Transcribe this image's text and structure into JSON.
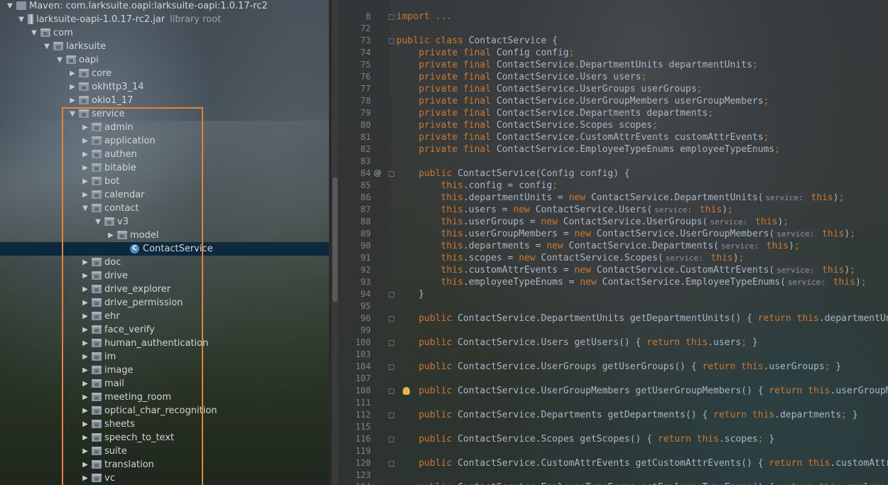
{
  "project_tree": {
    "nodes": [
      {
        "label": "Maven: com.larksuite.oapi:larksuite-oapi:1.0.17-rc2",
        "sublabel": "",
        "arrow": "▼",
        "icon": "maven"
      },
      {
        "label": "larksuite-oapi-1.0.17-rc2.jar",
        "sublabel": "library root",
        "arrow": "▼",
        "icon": "jar"
      },
      {
        "label": "com",
        "sublabel": "",
        "arrow": "▼",
        "icon": "package"
      },
      {
        "label": "larksuite",
        "sublabel": "",
        "arrow": "▼",
        "icon": "package"
      },
      {
        "label": "oapi",
        "sublabel": "",
        "arrow": "▼",
        "icon": "package"
      },
      {
        "label": "core",
        "sublabel": "",
        "arrow": "▶",
        "icon": "package"
      },
      {
        "label": "okhttp3_14",
        "sublabel": "",
        "arrow": "▶",
        "icon": "package"
      },
      {
        "label": "okio1_17",
        "sublabel": "",
        "arrow": "▶",
        "icon": "package"
      },
      {
        "label": "service",
        "sublabel": "",
        "arrow": "▼",
        "icon": "package"
      },
      {
        "label": "admin",
        "sublabel": "",
        "arrow": "▶",
        "icon": "package"
      },
      {
        "label": "application",
        "sublabel": "",
        "arrow": "▶",
        "icon": "package"
      },
      {
        "label": "authen",
        "sublabel": "",
        "arrow": "▶",
        "icon": "package"
      },
      {
        "label": "bitable",
        "sublabel": "",
        "arrow": "▶",
        "icon": "package"
      },
      {
        "label": "bot",
        "sublabel": "",
        "arrow": "▶",
        "icon": "package"
      },
      {
        "label": "calendar",
        "sublabel": "",
        "arrow": "▶",
        "icon": "package"
      },
      {
        "label": "contact",
        "sublabel": "",
        "arrow": "▼",
        "icon": "package"
      },
      {
        "label": "v3",
        "sublabel": "",
        "arrow": "▼",
        "icon": "package"
      },
      {
        "label": "model",
        "sublabel": "",
        "arrow": "▶",
        "icon": "package"
      },
      {
        "label": "ContactService",
        "sublabel": "",
        "arrow": "",
        "icon": "class"
      },
      {
        "label": "doc",
        "sublabel": "",
        "arrow": "▶",
        "icon": "package"
      },
      {
        "label": "drive",
        "sublabel": "",
        "arrow": "▶",
        "icon": "package"
      },
      {
        "label": "drive_explorer",
        "sublabel": "",
        "arrow": "▶",
        "icon": "package"
      },
      {
        "label": "drive_permission",
        "sublabel": "",
        "arrow": "▶",
        "icon": "package"
      },
      {
        "label": "ehr",
        "sublabel": "",
        "arrow": "▶",
        "icon": "package"
      },
      {
        "label": "face_verify",
        "sublabel": "",
        "arrow": "▶",
        "icon": "package"
      },
      {
        "label": "human_authentication",
        "sublabel": "",
        "arrow": "▶",
        "icon": "package"
      },
      {
        "label": "im",
        "sublabel": "",
        "arrow": "▶",
        "icon": "package"
      },
      {
        "label": "image",
        "sublabel": "",
        "arrow": "▶",
        "icon": "package"
      },
      {
        "label": "mail",
        "sublabel": "",
        "arrow": "▶",
        "icon": "package"
      },
      {
        "label": "meeting_room",
        "sublabel": "",
        "arrow": "▶",
        "icon": "package"
      },
      {
        "label": "optical_char_recognition",
        "sublabel": "",
        "arrow": "▶",
        "icon": "package"
      },
      {
        "label": "sheets",
        "sublabel": "",
        "arrow": "▶",
        "icon": "package"
      },
      {
        "label": "speech_to_text",
        "sublabel": "",
        "arrow": "▶",
        "icon": "package"
      },
      {
        "label": "suite",
        "sublabel": "",
        "arrow": "▶",
        "icon": "package"
      },
      {
        "label": "translation",
        "sublabel": "",
        "arrow": "▶",
        "icon": "package"
      },
      {
        "label": "vc",
        "sublabel": "",
        "arrow": "▶",
        "icon": "package"
      }
    ],
    "selected_label": "ContactService",
    "highlight_color": "#e8832e"
  },
  "editor": {
    "colors": {
      "keyword": "#cc7832",
      "text": "#a9b7c6",
      "hint": "#8f9499",
      "line_number": "#7d8287"
    },
    "gutter_marks": [
      {
        "line": "84",
        "mark": "@"
      },
      {
        "line": "108",
        "mark": "bulb"
      }
    ],
    "lines": [
      {
        "n": "8",
        "code": [
          [
            "kw",
            "import"
          ],
          [
            "t",
            " "
          ],
          [
            "fold",
            "..."
          ]
        ]
      },
      {
        "n": "72",
        "code": []
      },
      {
        "n": "73",
        "code": [
          [
            "kw",
            "public class"
          ],
          [
            "t",
            " ContactService {"
          ]
        ]
      },
      {
        "n": "74",
        "code": [
          [
            "t",
            "    "
          ],
          [
            "kw",
            "private final"
          ],
          [
            "t",
            " Config config"
          ],
          [
            "kw",
            ";"
          ]
        ]
      },
      {
        "n": "75",
        "code": [
          [
            "t",
            "    "
          ],
          [
            "kw",
            "private final"
          ],
          [
            "t",
            " ContactService.DepartmentUnits departmentUnits"
          ],
          [
            "kw",
            ";"
          ]
        ]
      },
      {
        "n": "76",
        "code": [
          [
            "t",
            "    "
          ],
          [
            "kw",
            "private final"
          ],
          [
            "t",
            " ContactService.Users users"
          ],
          [
            "kw",
            ";"
          ]
        ]
      },
      {
        "n": "77",
        "code": [
          [
            "t",
            "    "
          ],
          [
            "kw",
            "private final"
          ],
          [
            "t",
            " ContactService.UserGroups userGroups"
          ],
          [
            "kw",
            ";"
          ]
        ]
      },
      {
        "n": "78",
        "code": [
          [
            "t",
            "    "
          ],
          [
            "kw",
            "private final"
          ],
          [
            "t",
            " ContactService.UserGroupMembers userGroupMembers"
          ],
          [
            "kw",
            ";"
          ]
        ]
      },
      {
        "n": "79",
        "code": [
          [
            "t",
            "    "
          ],
          [
            "kw",
            "private final"
          ],
          [
            "t",
            " ContactService.Departments departments"
          ],
          [
            "kw",
            ";"
          ]
        ]
      },
      {
        "n": "80",
        "code": [
          [
            "t",
            "    "
          ],
          [
            "kw",
            "private final"
          ],
          [
            "t",
            " ContactService.Scopes scopes"
          ],
          [
            "kw",
            ";"
          ]
        ]
      },
      {
        "n": "81",
        "code": [
          [
            "t",
            "    "
          ],
          [
            "kw",
            "private final"
          ],
          [
            "t",
            " ContactService.CustomAttrEvents customAttrEvents"
          ],
          [
            "kw",
            ";"
          ]
        ]
      },
      {
        "n": "82",
        "code": [
          [
            "t",
            "    "
          ],
          [
            "kw",
            "private final"
          ],
          [
            "t",
            " ContactService.EmployeeTypeEnums employeeTypeEnums"
          ],
          [
            "kw",
            ";"
          ]
        ]
      },
      {
        "n": "83",
        "code": []
      },
      {
        "n": "84",
        "code": [
          [
            "t",
            "    "
          ],
          [
            "kw",
            "public"
          ],
          [
            "t",
            " ContactService(Config config) {"
          ]
        ]
      },
      {
        "n": "85",
        "code": [
          [
            "t",
            "        "
          ],
          [
            "kw",
            "this"
          ],
          [
            "t",
            ".config = config"
          ],
          [
            "kw",
            ";"
          ]
        ]
      },
      {
        "n": "86",
        "code": [
          [
            "t",
            "        "
          ],
          [
            "kw",
            "this"
          ],
          [
            "t",
            ".departmentUnits = "
          ],
          [
            "kw",
            "new"
          ],
          [
            "t",
            " ContactService.DepartmentUnits("
          ],
          [
            "hint",
            "service:"
          ],
          [
            "t",
            " "
          ],
          [
            "kw",
            "this"
          ],
          [
            "t",
            ")"
          ],
          [
            "kw",
            ";"
          ]
        ]
      },
      {
        "n": "87",
        "code": [
          [
            "t",
            "        "
          ],
          [
            "kw",
            "this"
          ],
          [
            "t",
            ".users = "
          ],
          [
            "kw",
            "new"
          ],
          [
            "t",
            " ContactService.Users("
          ],
          [
            "hint",
            "service:"
          ],
          [
            "t",
            " "
          ],
          [
            "kw",
            "this"
          ],
          [
            "t",
            ")"
          ],
          [
            "kw",
            ";"
          ]
        ]
      },
      {
        "n": "88",
        "code": [
          [
            "t",
            "        "
          ],
          [
            "kw",
            "this"
          ],
          [
            "t",
            ".userGroups = "
          ],
          [
            "kw",
            "new"
          ],
          [
            "t",
            " ContactService.UserGroups("
          ],
          [
            "hint",
            "service:"
          ],
          [
            "t",
            " "
          ],
          [
            "kw",
            "this"
          ],
          [
            "t",
            ")"
          ],
          [
            "kw",
            ";"
          ]
        ]
      },
      {
        "n": "89",
        "code": [
          [
            "t",
            "        "
          ],
          [
            "kw",
            "this"
          ],
          [
            "t",
            ".userGroupMembers = "
          ],
          [
            "kw",
            "new"
          ],
          [
            "t",
            " ContactService.UserGroupMembers("
          ],
          [
            "hint",
            "service:"
          ],
          [
            "t",
            " "
          ],
          [
            "kw",
            "this"
          ],
          [
            "t",
            ")"
          ],
          [
            "kw",
            ";"
          ]
        ]
      },
      {
        "n": "90",
        "code": [
          [
            "t",
            "        "
          ],
          [
            "kw",
            "this"
          ],
          [
            "t",
            ".departments = "
          ],
          [
            "kw",
            "new"
          ],
          [
            "t",
            " ContactService.Departments("
          ],
          [
            "hint",
            "service:"
          ],
          [
            "t",
            " "
          ],
          [
            "kw",
            "this"
          ],
          [
            "t",
            ")"
          ],
          [
            "kw",
            ";"
          ]
        ]
      },
      {
        "n": "91",
        "code": [
          [
            "t",
            "        "
          ],
          [
            "kw",
            "this"
          ],
          [
            "t",
            ".scopes = "
          ],
          [
            "kw",
            "new"
          ],
          [
            "t",
            " ContactService.Scopes("
          ],
          [
            "hint",
            "service:"
          ],
          [
            "t",
            " "
          ],
          [
            "kw",
            "this"
          ],
          [
            "t",
            ")"
          ],
          [
            "kw",
            ";"
          ]
        ]
      },
      {
        "n": "92",
        "code": [
          [
            "t",
            "        "
          ],
          [
            "kw",
            "this"
          ],
          [
            "t",
            ".customAttrEvents = "
          ],
          [
            "kw",
            "new"
          ],
          [
            "t",
            " ContactService.CustomAttrEvents("
          ],
          [
            "hint",
            "service:"
          ],
          [
            "t",
            " "
          ],
          [
            "kw",
            "this"
          ],
          [
            "t",
            ")"
          ],
          [
            "kw",
            ";"
          ]
        ]
      },
      {
        "n": "93",
        "code": [
          [
            "t",
            "        "
          ],
          [
            "kw",
            "this"
          ],
          [
            "t",
            ".employeeTypeEnums = "
          ],
          [
            "kw",
            "new"
          ],
          [
            "t",
            " ContactService.EmployeeTypeEnums("
          ],
          [
            "hint",
            "service:"
          ],
          [
            "t",
            " "
          ],
          [
            "kw",
            "this"
          ],
          [
            "t",
            ")"
          ],
          [
            "kw",
            ";"
          ]
        ]
      },
      {
        "n": "94",
        "code": [
          [
            "t",
            "    }"
          ]
        ]
      },
      {
        "n": "95",
        "code": []
      },
      {
        "n": "96",
        "code": [
          [
            "t",
            "    "
          ],
          [
            "kw",
            "public"
          ],
          [
            "t",
            " ContactService.DepartmentUnits getDepartmentUnits() { "
          ],
          [
            "kw",
            "return this"
          ],
          [
            "t",
            ".departmentUnits"
          ],
          [
            "kw",
            ";"
          ],
          [
            "t",
            " }"
          ]
        ]
      },
      {
        "n": "99",
        "code": []
      },
      {
        "n": "100",
        "code": [
          [
            "t",
            "    "
          ],
          [
            "kw",
            "public"
          ],
          [
            "t",
            " ContactService.Users getUsers() { "
          ],
          [
            "kw",
            "return this"
          ],
          [
            "t",
            ".users"
          ],
          [
            "kw",
            ";"
          ],
          [
            "t",
            " }"
          ]
        ]
      },
      {
        "n": "103",
        "code": []
      },
      {
        "n": "104",
        "code": [
          [
            "t",
            "    "
          ],
          [
            "kw",
            "public"
          ],
          [
            "t",
            " ContactService.UserGroups getUserGroups() { "
          ],
          [
            "kw",
            "return this"
          ],
          [
            "t",
            ".userGroups"
          ],
          [
            "kw",
            ";"
          ],
          [
            "t",
            " }"
          ]
        ]
      },
      {
        "n": "107",
        "code": []
      },
      {
        "n": "108",
        "code": [
          [
            "t",
            "    "
          ],
          [
            "kw",
            "public"
          ],
          [
            "t",
            " ContactService.UserGroupMembers getUserGroupMembers() { "
          ],
          [
            "kw",
            "return this"
          ],
          [
            "t",
            ".userGroupMembers"
          ],
          [
            "kw",
            ";"
          ],
          [
            "t",
            " }"
          ]
        ]
      },
      {
        "n": "111",
        "code": []
      },
      {
        "n": "112",
        "code": [
          [
            "t",
            "    "
          ],
          [
            "kw",
            "public"
          ],
          [
            "t",
            " ContactService.Departments getDepartments() { "
          ],
          [
            "kw",
            "return this"
          ],
          [
            "t",
            ".departments"
          ],
          [
            "kw",
            ";"
          ],
          [
            "t",
            " }"
          ]
        ]
      },
      {
        "n": "115",
        "code": []
      },
      {
        "n": "116",
        "code": [
          [
            "t",
            "    "
          ],
          [
            "kw",
            "public"
          ],
          [
            "t",
            " ContactService.Scopes getScopes() { "
          ],
          [
            "kw",
            "return this"
          ],
          [
            "t",
            ".scopes"
          ],
          [
            "kw",
            ";"
          ],
          [
            "t",
            " }"
          ]
        ]
      },
      {
        "n": "119",
        "code": []
      },
      {
        "n": "120",
        "code": [
          [
            "t",
            "    "
          ],
          [
            "kw",
            "public"
          ],
          [
            "t",
            " ContactService.CustomAttrEvents getCustomAttrEvents() { "
          ],
          [
            "kw",
            "return this"
          ],
          [
            "t",
            ".customAttrEvents"
          ],
          [
            "kw",
            ";"
          ],
          [
            "t",
            " }"
          ]
        ]
      },
      {
        "n": "123",
        "code": []
      },
      {
        "n": "124",
        "code": [
          [
            "t",
            "    "
          ],
          [
            "kw",
            "public"
          ],
          [
            "t",
            " ContactService.EmployeeTypeEnums getEmployeeTypeEnums() { "
          ],
          [
            "kw",
            "return this"
          ],
          [
            "t",
            ".employeeTypeEnums"
          ],
          [
            "kw",
            ";"
          ],
          [
            "t",
            " }"
          ]
        ]
      }
    ]
  }
}
